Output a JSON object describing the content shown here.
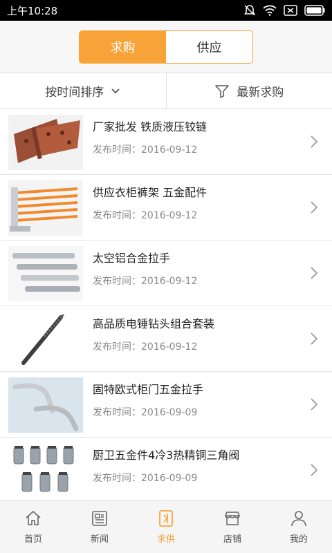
{
  "status": {
    "time": "上午10:28",
    "icons": [
      "mute-bell-icon",
      "wifi-icon",
      "sim-card-icon",
      "battery-icon"
    ]
  },
  "tabs": [
    {
      "label": "求购",
      "active": true
    },
    {
      "label": "供应",
      "active": false
    }
  ],
  "filters": {
    "sort_label": "按时间排序",
    "sort_icon": "chevron-down-icon",
    "filter_label": "最新求购",
    "filter_icon": "funnel-icon"
  },
  "items": [
    {
      "title": "厂家批发 铁质液压铰链",
      "date": "发布时间：2016-09-12",
      "thumb": "hinge-image"
    },
    {
      "title": "供应衣柜裤架 五金配件",
      "date": "发布时间：2016-09-12",
      "thumb": "trouser-rack-image"
    },
    {
      "title": "太空铝合金拉手",
      "date": "发布时间：2016-09-12",
      "thumb": "aluminum-handles-image"
    },
    {
      "title": "高品质电锤钻头组合套装",
      "date": "发布时间：2016-09-12",
      "thumb": "drill-bit-image"
    },
    {
      "title": "固特欧式柜门五金拉手",
      "date": "发布时间：2016-09-09",
      "thumb": "cabinet-handles-image"
    },
    {
      "title": "厨卫五金件4冷3热精铜三角阀",
      "date": "发布时间：2016-09-09",
      "thumb": "angle-valves-image"
    }
  ],
  "nav": [
    {
      "label": "首页",
      "icon": "home-icon",
      "active": false
    },
    {
      "label": "新闻",
      "icon": "news-icon",
      "active": false
    },
    {
      "label": "求供",
      "icon": "supply-demand-icon",
      "active": true
    },
    {
      "label": "店铺",
      "icon": "shop-icon",
      "active": false
    },
    {
      "label": "我的",
      "icon": "user-icon",
      "active": false
    }
  ],
  "colors": {
    "accent": "#f7a338",
    "statusbar": "#000000",
    "text": "#222222",
    "subtext": "#888888"
  }
}
